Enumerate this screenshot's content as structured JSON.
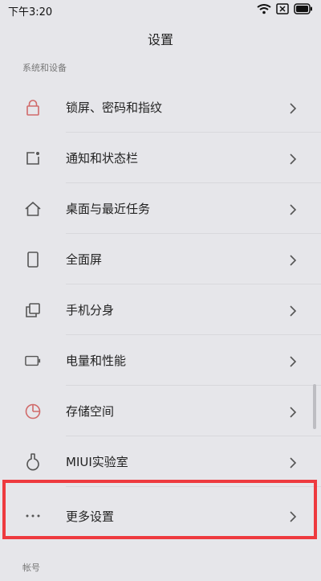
{
  "status_bar": {
    "time": "下午3:20"
  },
  "header": {
    "title": "设置"
  },
  "sections": {
    "system_header": "系统和设备",
    "account_header": "帐号"
  },
  "menu": {
    "items": [
      {
        "label": "锁屏、密码和指纹",
        "icon": "lock-icon"
      },
      {
        "label": "通知和状态栏",
        "icon": "notification-icon"
      },
      {
        "label": "桌面与最近任务",
        "icon": "home-icon"
      },
      {
        "label": "全面屏",
        "icon": "fullscreen-icon"
      },
      {
        "label": "手机分身",
        "icon": "dual-space-icon"
      },
      {
        "label": "电量和性能",
        "icon": "battery-icon"
      },
      {
        "label": "存储空间",
        "icon": "storage-icon"
      },
      {
        "label": "MIUI实验室",
        "icon": "flask-icon"
      },
      {
        "label": "更多设置",
        "icon": "more-icon"
      }
    ]
  },
  "colors": {
    "background": "#e6e6ea",
    "highlight": "#ee3a3f",
    "lock_icon": "#d06a6a",
    "icon_gray": "#555555"
  }
}
